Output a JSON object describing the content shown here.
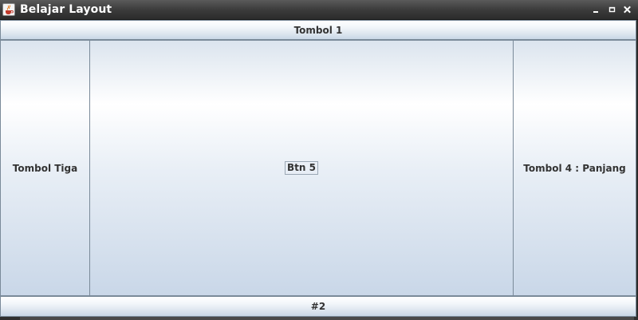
{
  "window": {
    "title": "Belajar Layout",
    "icon": "java-cup-icon",
    "controls": [
      "minimize-icon",
      "maximize-icon",
      "close-icon"
    ]
  },
  "layout": {
    "north": {
      "label": "Tombol 1"
    },
    "west": {
      "label": "Tombol Tiga"
    },
    "center": {
      "label": "Btn 5"
    },
    "east": {
      "label": "Tombol 4 : Panjang"
    },
    "south": {
      "label": "#2"
    }
  },
  "colors": {
    "titlebar": "#3c3c3c",
    "button_border": "#7a8a99",
    "button_text": "#333333"
  }
}
